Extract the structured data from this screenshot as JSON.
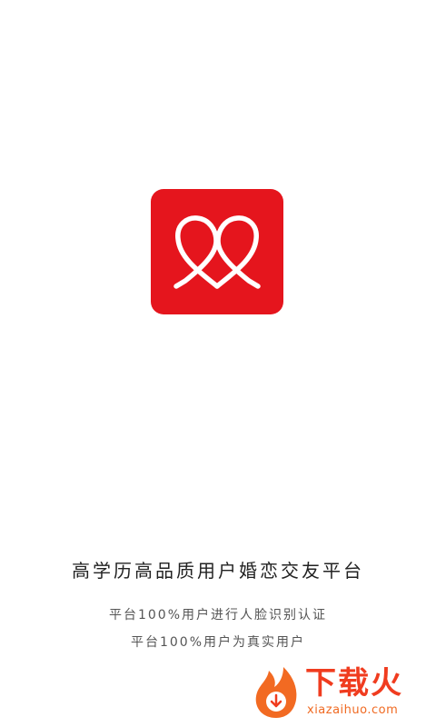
{
  "app": {
    "logo_icon": "heart-knot-icon",
    "brand_color": "#e5151d"
  },
  "tagline": "高学历高品质用户婚恋交友平台",
  "features": [
    "平台100%用户进行人脸识别认证",
    "平台100%用户为真实用户"
  ],
  "watermark": {
    "icon": "flame-download-icon",
    "title": "下载火",
    "url": "xiazaihuo.com",
    "color": "#f03c1f"
  }
}
